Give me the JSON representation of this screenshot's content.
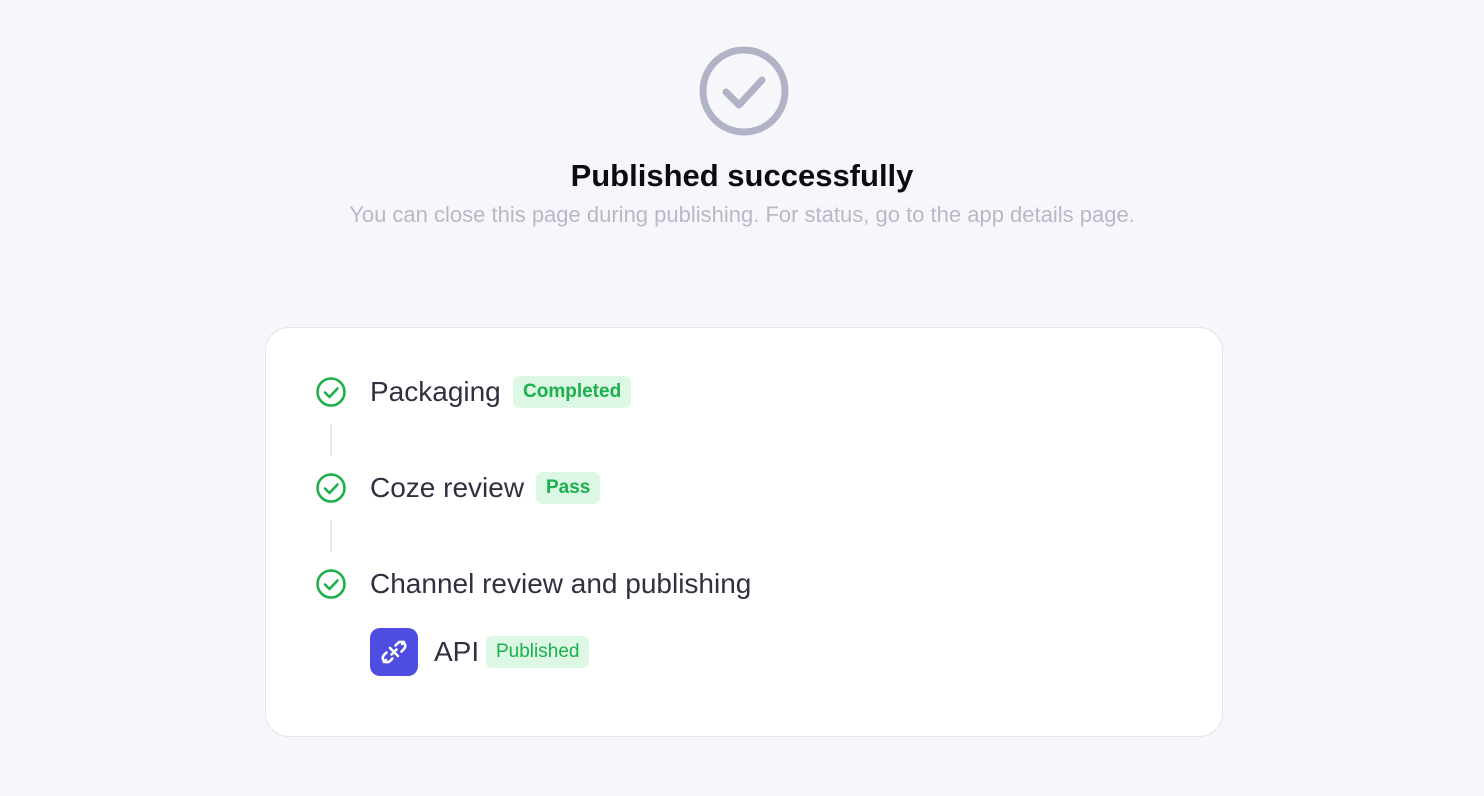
{
  "header": {
    "title": "Published successfully",
    "subtitle": "You can close this page during publishing. For status, go to the app details page.",
    "icon": "check-circle-icon"
  },
  "steps": [
    {
      "label": "Packaging",
      "badge": "Completed",
      "icon": "check-circle-icon"
    },
    {
      "label": "Coze review",
      "badge": "Pass",
      "icon": "check-circle-icon"
    },
    {
      "label": "Channel review and publishing",
      "icon": "check-circle-icon"
    }
  ],
  "channels": [
    {
      "name": "API",
      "status": "Published",
      "icon": "link-icon"
    }
  ],
  "colors": {
    "success": "#1bb04c",
    "badge_bg": "#dcf8e4",
    "hero_icon": "#b0b3c5",
    "channel_icon_bg": "#4f4de1"
  }
}
